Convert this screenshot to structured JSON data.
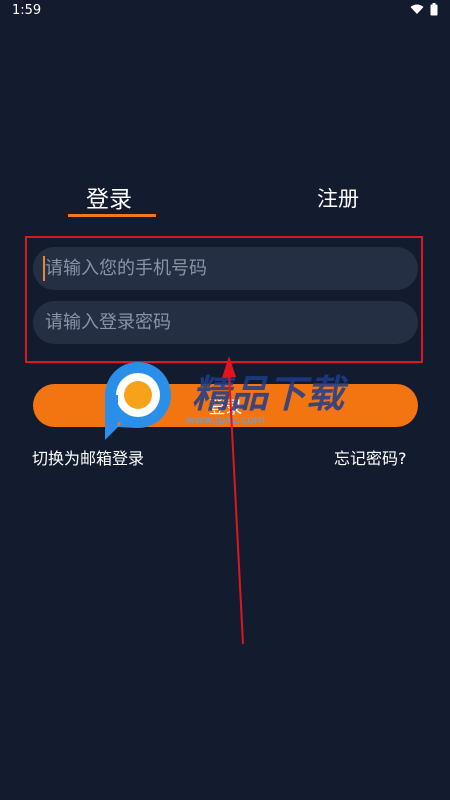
{
  "status_bar": {
    "time": "1:59",
    "icons": [
      "wifi-icon",
      "battery-icon"
    ]
  },
  "tabs": {
    "login": "登录",
    "register": "注册",
    "active": "login"
  },
  "form": {
    "phone_placeholder": "请输入您的手机号码",
    "password_placeholder": "请输入登录密码"
  },
  "login_button": {
    "label": "登录"
  },
  "links": {
    "switch_email": "切换为邮箱登录",
    "forgot_password": "忘记密码?"
  },
  "watermark": {
    "text": "精品下载",
    "url": "www.jpxz.com",
    "badge": "P"
  },
  "colors": {
    "background": "#131c2f",
    "accent": "#f27512",
    "input_bg": "#252f43",
    "annotation": "#e0151e"
  }
}
